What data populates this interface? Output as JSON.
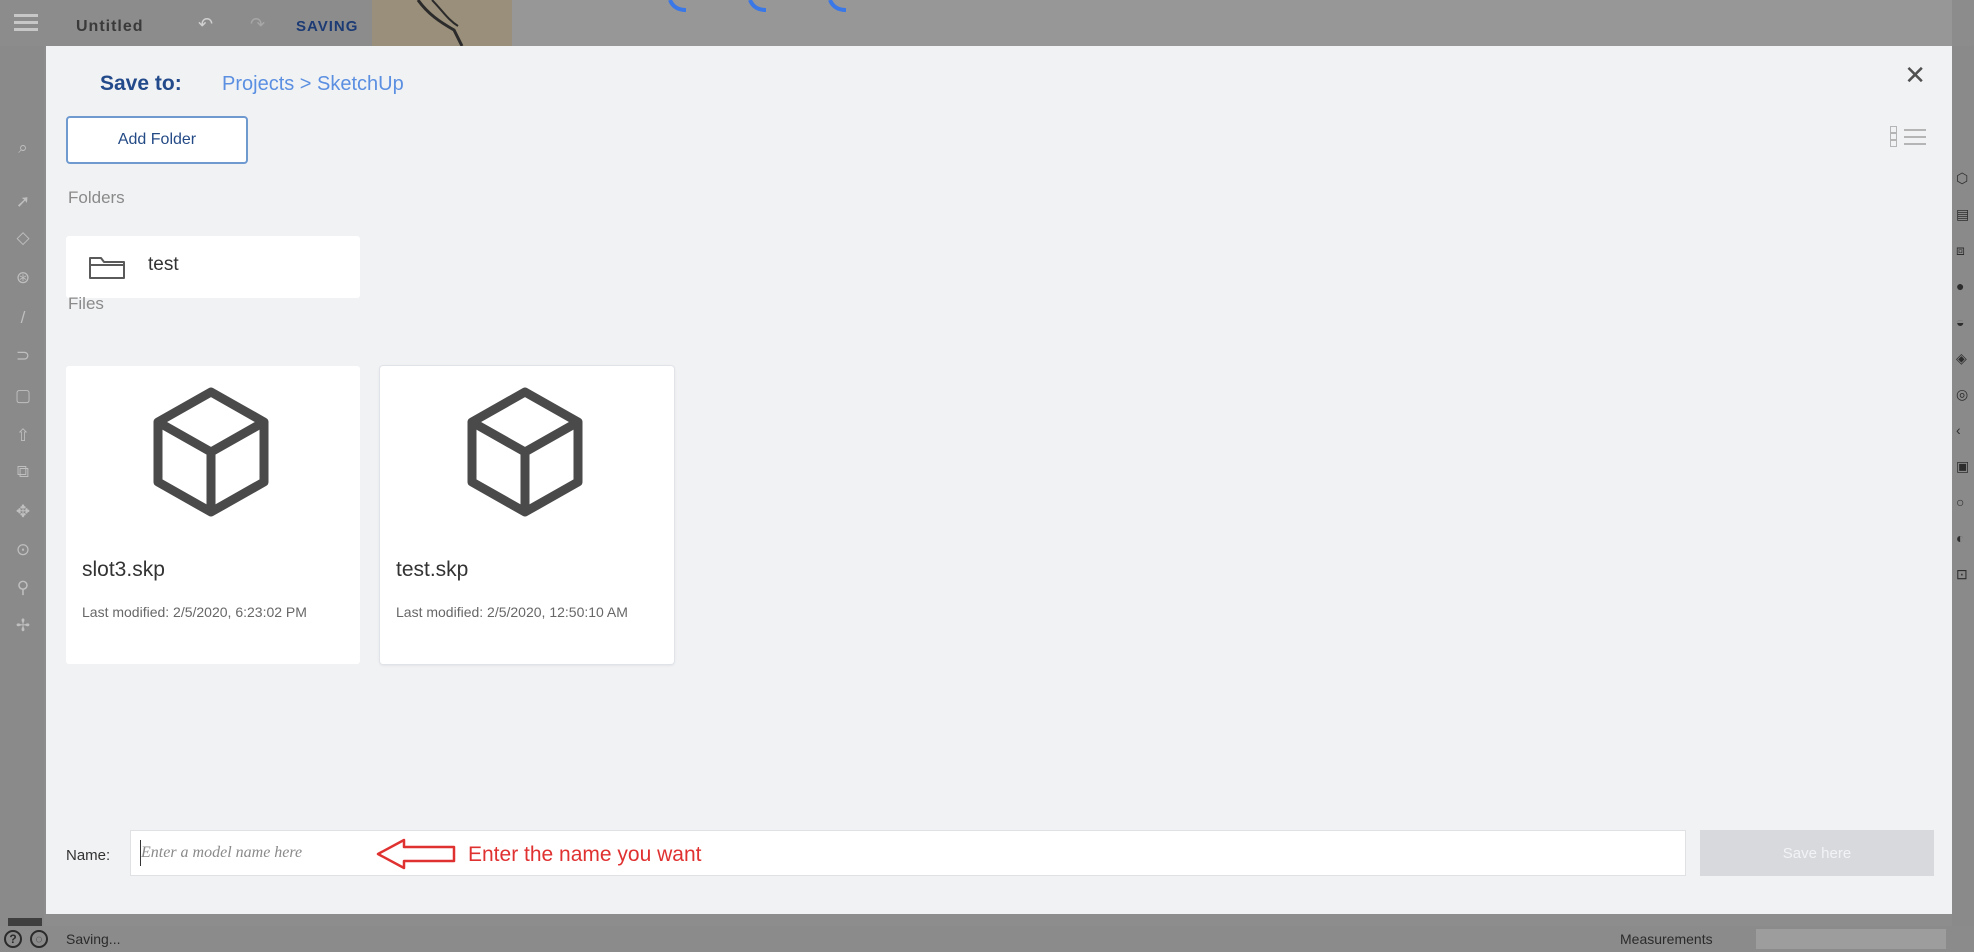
{
  "app": {
    "title": "Untitled",
    "saving_badge": "SAVING",
    "status_text": "Saving...",
    "measurements_label": "Measurements"
  },
  "dialog": {
    "save_to_label": "Save to:",
    "breadcrumb": "Projects > SketchUp",
    "add_folder_label": "Add Folder",
    "folders_section": "Folders",
    "files_section": "Files",
    "folders": [
      {
        "name": "test",
        "icon": "folder-icon"
      }
    ],
    "files": [
      {
        "name": "slot3.skp",
        "modified": "Last modified: 2/5/2020, 6:23:02 PM",
        "icon": "cube-icon",
        "selected": false
      },
      {
        "name": "test.skp",
        "modified": "Last modified: 2/5/2020, 12:50:10 AM",
        "icon": "cube-icon",
        "selected": true
      }
    ],
    "name_label": "Name:",
    "name_value": "",
    "name_placeholder": "Enter a model name here",
    "annotation": "Enter the name you want",
    "save_button_label": "Save here",
    "close_icon": "close-icon",
    "view_toggle_icon": "list-view-icon"
  },
  "colors": {
    "accent": "#234a8a",
    "breadcrumb": "#5b8fe1",
    "annotation": "#e03131",
    "dialog_bg": "#f1f2f4"
  }
}
